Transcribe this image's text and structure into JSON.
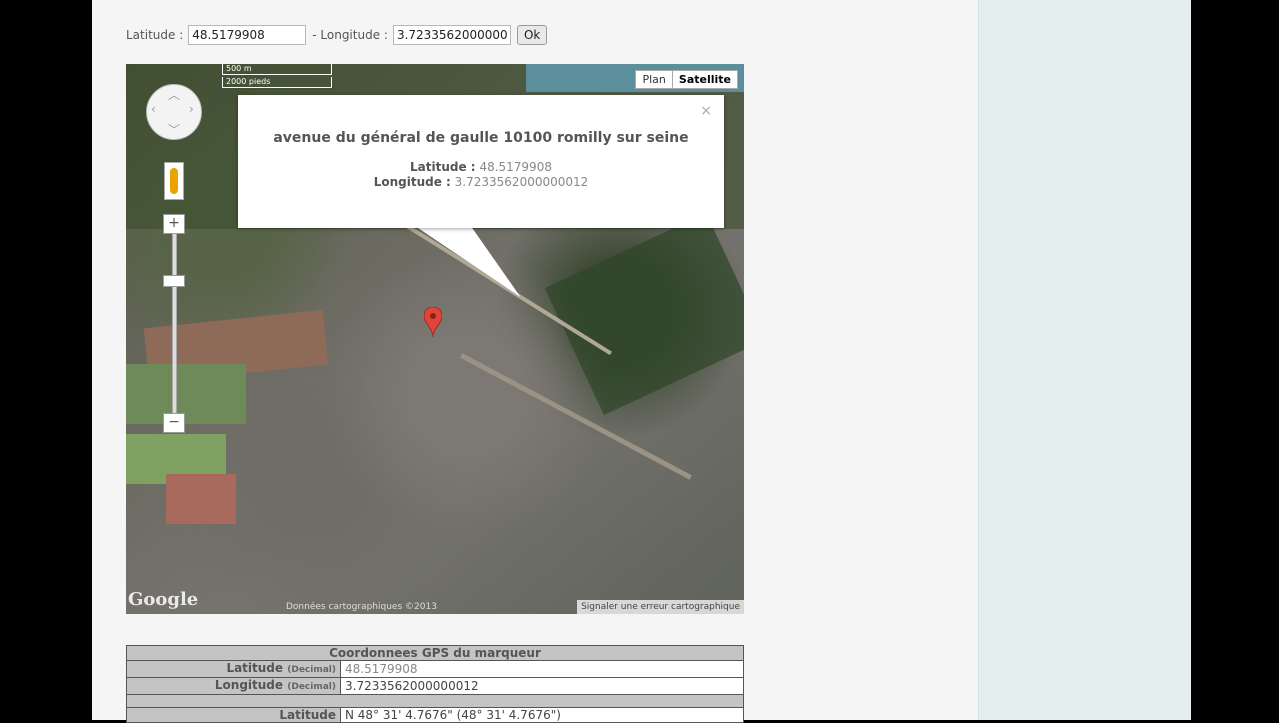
{
  "form": {
    "lat_label": "Latitude :",
    "lat_value": "48.5179908",
    "lng_label": "- Longitude :",
    "lng_value": "3.7233562000000",
    "ok_label": "Ok"
  },
  "map": {
    "type_plan": "Plan",
    "type_satellite": "Satellite",
    "scale_metric": "500 m",
    "scale_imperial": "2000 pieds",
    "logo": "Google",
    "attribution": "Données cartographiques ©2013",
    "report_error": "Signaler une erreur cartographique",
    "infowindow": {
      "address": "avenue du général de gaulle 10100 romilly sur seine",
      "lat_label": "Latitude :",
      "lat_value": "48.5179908",
      "lng_label": "Longitude :",
      "lng_value": "3.7233562000000012",
      "close": "×"
    }
  },
  "gps_table": {
    "title": "Coordonnees GPS du marqueur",
    "rows": [
      {
        "label": "Latitude",
        "unit": "(Decimal)",
        "value": "48.5179908"
      },
      {
        "label": "Longitude",
        "unit": "(Decimal)",
        "value": "3.7233562000000012"
      }
    ],
    "partial_label": "Latitude",
    "partial_value": "N 48° 31' 4.7676\" (48° 31' 4.7676\")"
  },
  "colors": {
    "pin": "#e0453a",
    "sidebar": "#e5eeee"
  }
}
